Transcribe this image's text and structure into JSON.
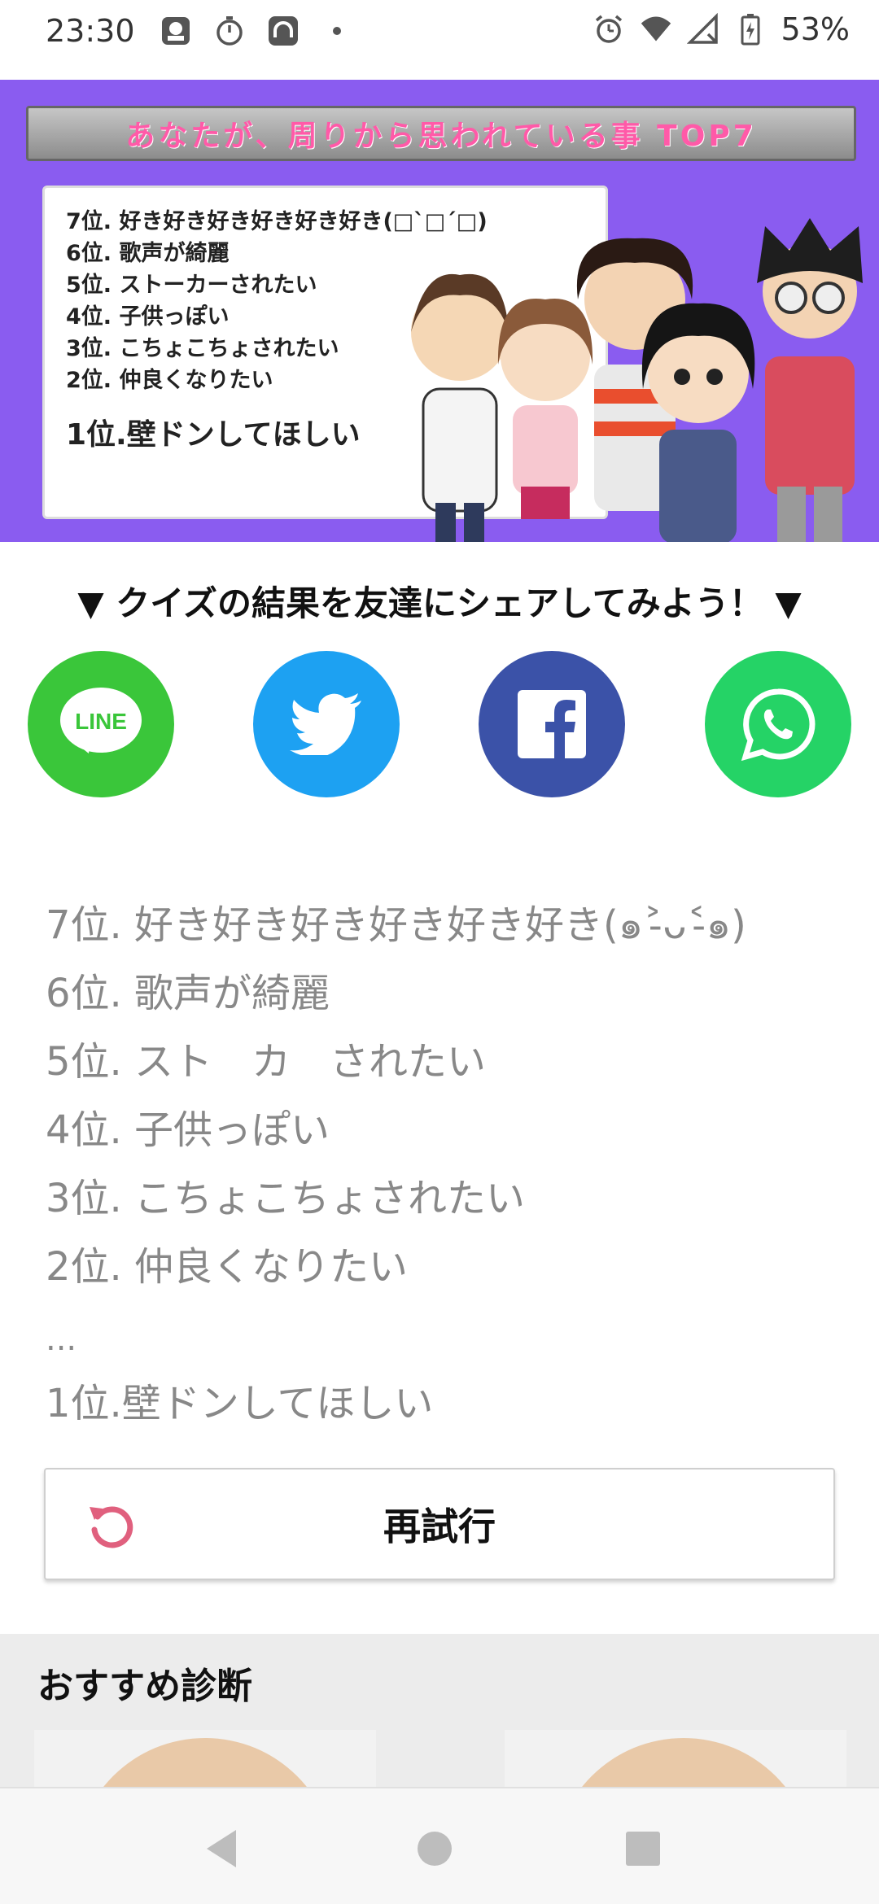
{
  "status_bar": {
    "time": "23:30",
    "battery": "53%",
    "icons_left": [
      "app-icon",
      "timer-icon",
      "headset-app-icon",
      "dot-icon"
    ],
    "icons_right": [
      "alarm-icon",
      "wifi-icon",
      "signal-icon",
      "battery-icon"
    ]
  },
  "hero": {
    "title": "あなたが、周りから思われている事 TOP7",
    "lines": [
      "7位. 好き好き好き好き好き好き(□`□´□)",
      "6位. 歌声が綺麗",
      "5位. ストーカーされたい",
      "4位. 子供っぽい",
      "3位. こちょこちょされたい",
      "2位. 仲良くなりたい"
    ],
    "top": "1位.壁ドンしてほしい",
    "bg_color": "#8a5cf0"
  },
  "share": {
    "heading": "▼ クイズの結果を友達にシェアしてみよう！ ▼",
    "buttons": [
      {
        "name": "LINE",
        "color": "#3ac63a",
        "icon": "line-icon",
        "label": "LINE"
      },
      {
        "name": "Twitter",
        "color": "#1da1f2",
        "icon": "twitter-icon"
      },
      {
        "name": "Facebook",
        "color": "#3b52a8",
        "icon": "facebook-icon"
      },
      {
        "name": "WhatsApp",
        "color": "#25d366",
        "icon": "whatsapp-icon"
      }
    ]
  },
  "ranks": {
    "r7": "7位. 好き好き好き好き好き好き(๑˃̵ᴗ˂̵๑)",
    "r6": "6位. 歌声が綺麗",
    "r5": "5位. スト　カ　されたい",
    "r4": "4位. 子供っぽい",
    "r3": "3位. こちょこちょされたい",
    "r2": "2位. 仲良くなりたい",
    "ellipsis": "...",
    "r1": "1位.壁ドンしてほしい"
  },
  "retry": {
    "label": "再試行",
    "icon_color": "#e0607e"
  },
  "recommended": {
    "title": "おすすめ診断"
  }
}
